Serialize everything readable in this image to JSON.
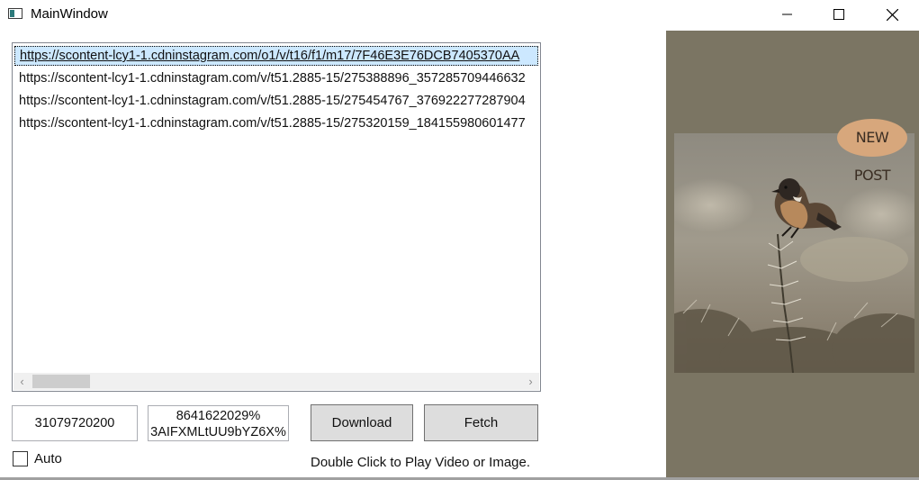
{
  "window": {
    "title": "MainWindow",
    "controls": {
      "minimize": "minimize-icon",
      "maximize": "maximize-icon",
      "close": "close-icon"
    }
  },
  "url_list": {
    "items": [
      "https://scontent-lcy1-1.cdninstagram.com/o1/v/t16/f1/m17/7F46E3E76DCB7405370AA",
      "https://scontent-lcy1-1.cdninstagram.com/v/t51.2885-15/275388896_357285709446632",
      "https://scontent-lcy1-1.cdninstagram.com/v/t51.2885-15/275454767_376922277287904",
      "https://scontent-lcy1-1.cdninstagram.com/v/t51.2885-15/275320159_184155980601477"
    ],
    "selected_index": 0
  },
  "inputs": {
    "user_id": "31079720200",
    "token_line1": "8641622029%",
    "token_line2": "3AIFXMLtUU9bYZ6X%"
  },
  "buttons": {
    "download": "Download",
    "fetch": "Fetch"
  },
  "auto": {
    "label": "Auto",
    "checked": false
  },
  "hint": "Double Click to Play Video or Image.",
  "preview": {
    "badge": "NEW POST",
    "background": "#7b7563",
    "badge_color": "#d7a77c"
  }
}
